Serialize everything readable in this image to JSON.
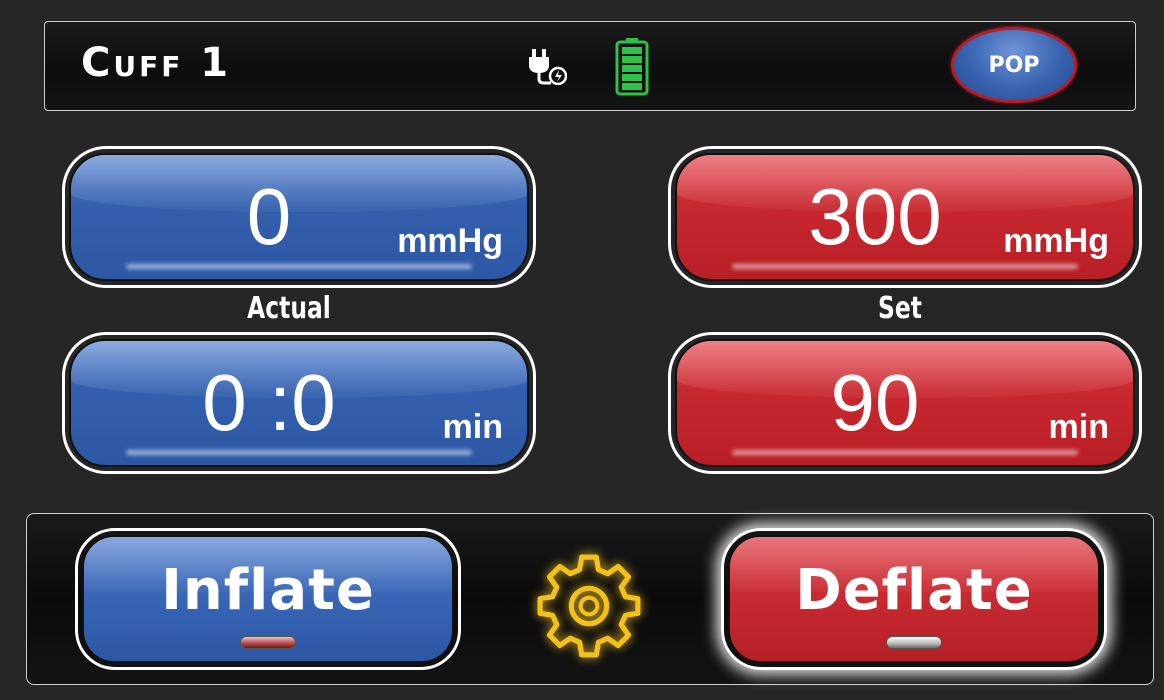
{
  "header": {
    "title": "Cuff 1",
    "pop_label": "POP",
    "icons": {
      "power": "plug-icon",
      "battery": "battery-full-icon"
    },
    "battery_color": "#2fc24a"
  },
  "actual": {
    "label": "Actual",
    "pressure": {
      "value": "0",
      "unit": "mmHg"
    },
    "time": {
      "value": "0 :0",
      "unit": "min"
    },
    "color": "#3563b2"
  },
  "set": {
    "label": "Set",
    "pressure": {
      "value": "300",
      "unit": "mmHg"
    },
    "time": {
      "value": "90",
      "unit": "min"
    },
    "color": "#c8282f"
  },
  "controls": {
    "inflate_label": "Inflate",
    "deflate_label": "Deflate",
    "settings_icon": "gear-icon",
    "settings_color": "#f2c21a"
  }
}
